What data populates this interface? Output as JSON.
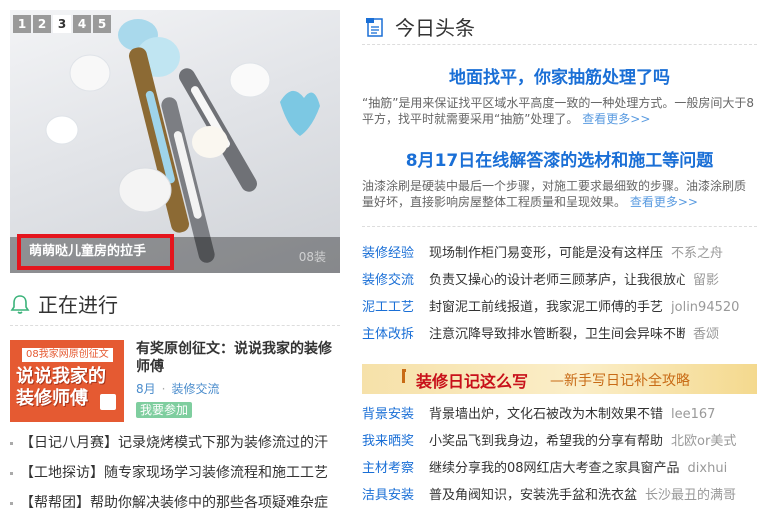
{
  "slider": {
    "dots": [
      "1",
      "2",
      "3",
      "4",
      "5"
    ],
    "active_index": 3,
    "caption": "萌萌哒儿童房的拉手",
    "watermark": "08装"
  },
  "ongoing": {
    "title": "正在进行",
    "activity": {
      "image_tag": "08我家网原创征文",
      "image_text": "说说我家的装修师傅",
      "title": "有奖原创征文：说说我家的装修师傅",
      "month": "8月",
      "category": "装修交流",
      "join_button": "我要参加"
    },
    "items": [
      "【日记八月赛】记录烧烤模式下那为装修流过的汗",
      "【工地探访】随专家现场学习装修流程和施工工艺",
      "【帮帮团】帮助你解决装修中的那些各项疑难杂症"
    ]
  },
  "news": {
    "title": "今日头条",
    "headlines": [
      {
        "title": "地面找平，你家抽筋处理了吗",
        "desc": "“抽筋”是用来保证找平区域水平高度一致的一种处理方式。一般房间大于8平方，找平时就需要采用“抽筋”处理了。",
        "more": "查看更多>>"
      },
      {
        "title": "8月17日在线解答漆的选材和施工等问题",
        "desc": "油漆涂刷是硬装中最后一个步骤，对施工要求最细致的步骤。油漆涂刷质量好坏，直接影响房屋整体工程质量和呈现效果。",
        "more": "查看更多>>"
      }
    ],
    "list1": [
      {
        "cat": "装修经验",
        "title": "现场制作柜门易变形，可能是没有这样压",
        "user": "不系之舟"
      },
      {
        "cat": "装修交流",
        "title": "负责又操心的设计老师三顾茅庐，让我很放心",
        "user": "留影"
      },
      {
        "cat": "泥工工艺",
        "title": "封窗泥工前线报道，我家泥工师傅的手艺",
        "user": "jolin94520"
      },
      {
        "cat": "主体改拆",
        "title": "注意沉降导致排水管断裂，卫生间会异味不断",
        "user": "香颂"
      }
    ],
    "banner": {
      "title": "装修日记这么写",
      "subtitle": "—新手写日记补全攻略"
    },
    "list2": [
      {
        "cat": "背景安装",
        "title": "背景墙出炉，文化石被改为木制效果不错",
        "user": "lee167"
      },
      {
        "cat": "我来晒奖",
        "title": "小奖品飞到我身边，希望我的分享有帮助",
        "user": "北欧or美式"
      },
      {
        "cat": "主材考察",
        "title": "继续分享我的08网红店大考查之家具窗产品",
        "user": "dixhui"
      },
      {
        "cat": "洁具安装",
        "title": "普及角阀知识，安装洗手盆和洗衣盆",
        "user": "长沙最丑的满哥"
      }
    ]
  },
  "colors": {
    "link_blue": "#1a6fd6",
    "caption_border": "#e4151d",
    "join_green": "#7fce9f",
    "banner_red": "#c8101a"
  }
}
